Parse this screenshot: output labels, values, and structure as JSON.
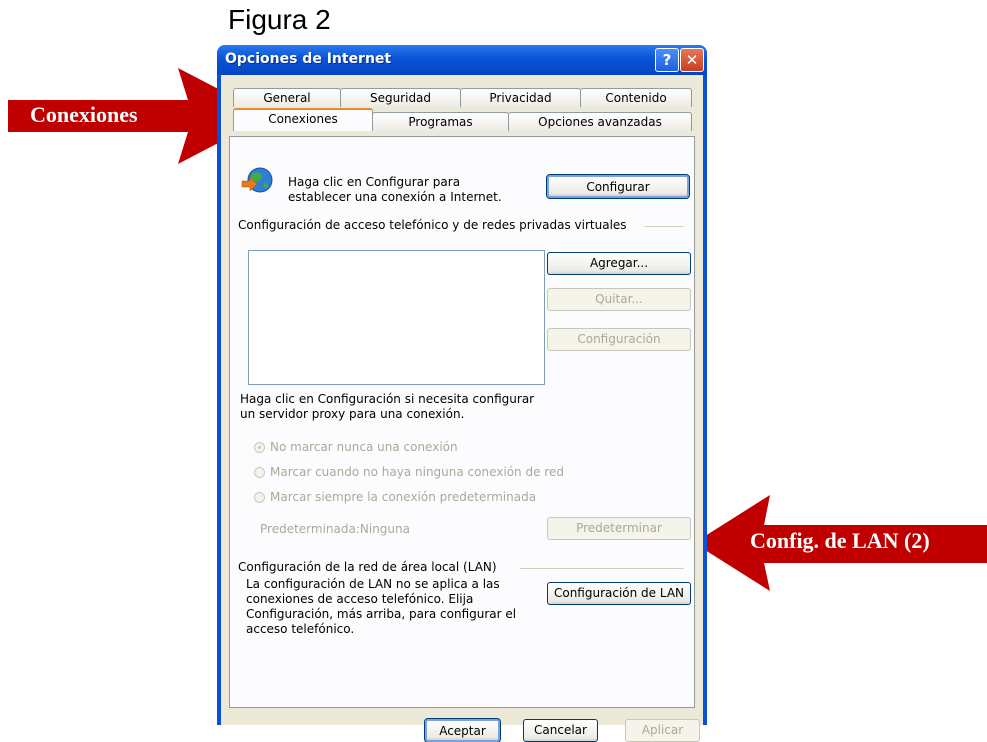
{
  "figure_caption": "Figura 2",
  "callouts": {
    "conexiones": "Conexiones",
    "lan": "Config. de LAN (2)"
  },
  "window": {
    "title": "Opciones de Internet",
    "help_glyph": "?",
    "close_glyph": "✕"
  },
  "tabs": {
    "row1": [
      "General",
      "Seguridad",
      "Privacidad",
      "Contenido"
    ],
    "row2": [
      "Conexiones",
      "Programas",
      "Opciones avanzadas"
    ],
    "active": "Conexiones"
  },
  "setup": {
    "text": "Haga clic en Configurar para establecer una conexión a Internet.",
    "button": "Configurar"
  },
  "dialup": {
    "group_label": "Configuración de acceso telefónico y de redes privadas virtuales",
    "add_button": "Agregar...",
    "remove_button": "Quitar...",
    "settings_button": "Configuración",
    "proxy_text": "Haga clic en Configuración si necesita configurar un servidor proxy para una conexión.",
    "radios": [
      "No marcar nunca una conexión",
      "Marcar cuando no haya ninguna conexión de red",
      "Marcar siempre la conexión predeterminada"
    ],
    "default_label": "Predeterminada:",
    "default_value": "Ninguna",
    "set_default_button": "Predeterminar"
  },
  "lan": {
    "group_label": "Configuración de la red de área local (LAN)",
    "text": "La configuración de LAN no se aplica a las conexiones de acceso telefónico. Elija Configuración, más arriba, para configurar el acceso telefónico.",
    "button": "Configuración de LAN"
  },
  "footer": {
    "ok": "Aceptar",
    "cancel": "Cancelar",
    "apply": "Aplicar"
  },
  "colors": {
    "callout_red": "#c00000",
    "xp_blue": "#0a50d8"
  }
}
